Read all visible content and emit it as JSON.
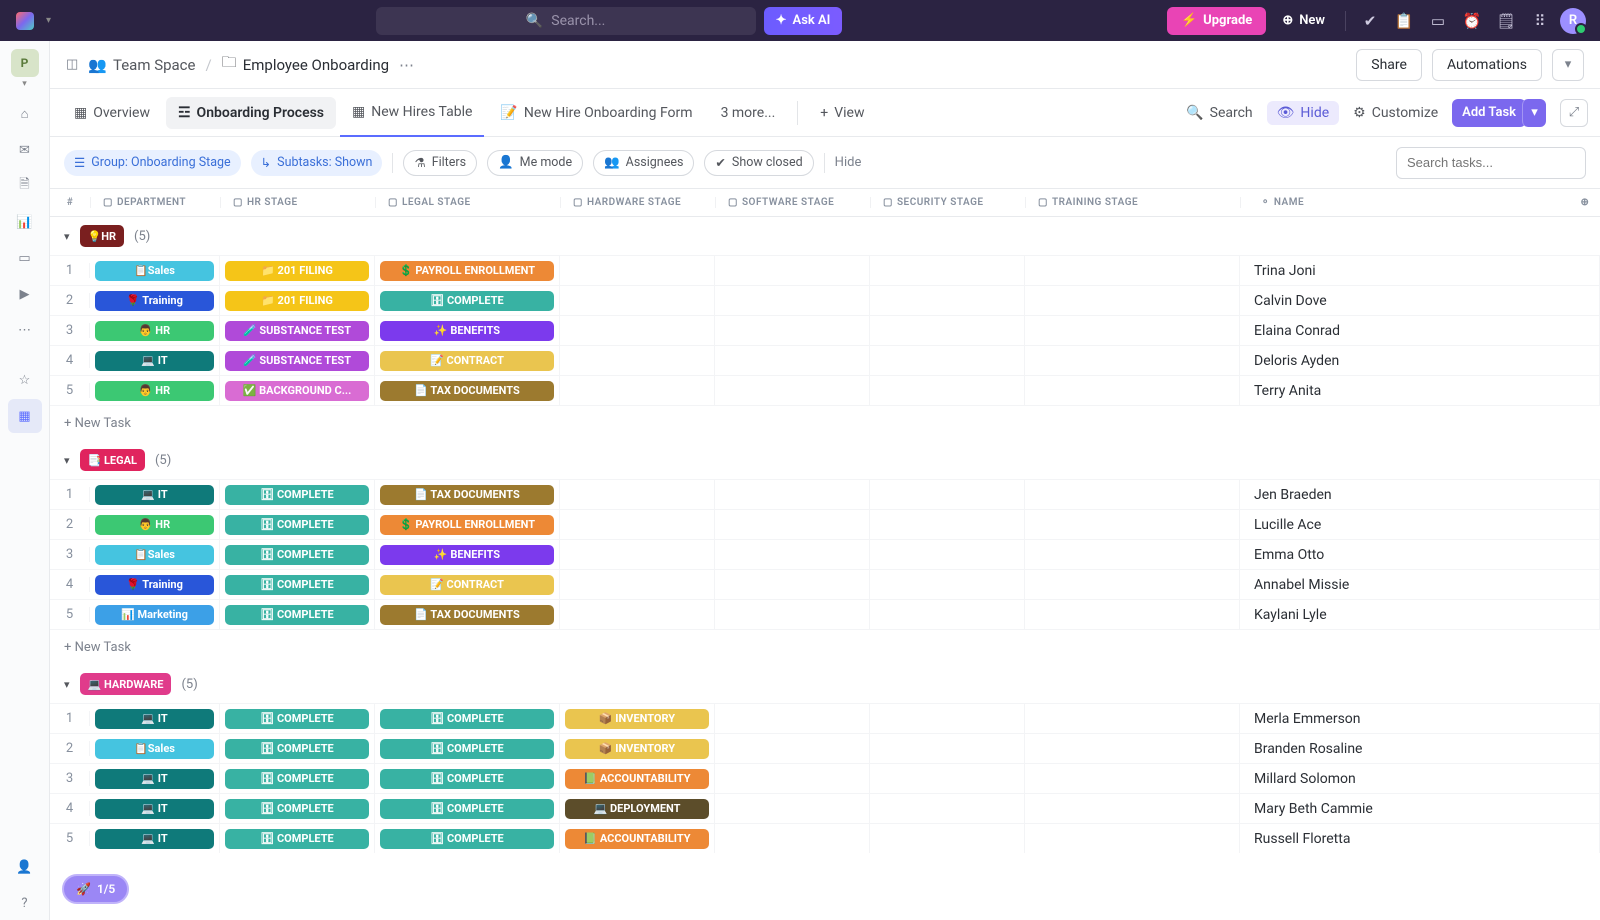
{
  "topbar": {
    "search_placeholder": "Search...",
    "ask_ai": "Ask AI",
    "upgrade": "Upgrade",
    "new": "New",
    "avatar_initial": "R"
  },
  "sidebar": {
    "workspace_initial": "P"
  },
  "breadcrumb": {
    "space": "Team Space",
    "folder": "Employee Onboarding"
  },
  "header_actions": {
    "share": "Share",
    "automations": "Automations"
  },
  "views": {
    "overview": "Overview",
    "process": "Onboarding Process",
    "table": "New Hires Table",
    "form": "New Hire Onboarding Form",
    "more": "3 more...",
    "add_view": "View"
  },
  "viewbar_actions": {
    "search": "Search",
    "hide": "Hide",
    "customize": "Customize",
    "add_task": "Add Task"
  },
  "chips": {
    "group": "Group: Onboarding Stage",
    "subtasks": "Subtasks: Shown",
    "filters": "Filters",
    "me_mode": "Me mode",
    "assignees": "Assignees",
    "show_closed": "Show closed",
    "hide": "Hide",
    "search_placeholder": "Search tasks..."
  },
  "columns": [
    "#",
    "DEPARTMENT",
    "HR STAGE",
    "LEGAL STAGE",
    "HARDWARE STAGE",
    "SOFTWARE STAGE",
    "SECURITY STAGE",
    "TRAINING STAGE",
    "NAME"
  ],
  "pill_colors": {
    "sales": "#45c4e0",
    "training": "#2956d9",
    "hr": "#3cc873",
    "it": "#0f7a7a",
    "marketing": "#3ca0e7",
    "201filing": "#f5c518",
    "substance": "#b04ad9",
    "background": "#d96cd3",
    "payroll": "#ed8936",
    "complete": "#38b2a3",
    "benefits": "#7c3aed",
    "contract": "#eac54f",
    "taxdocs": "#9c7a2f",
    "inventory": "#eac54f",
    "accountability": "#ed8936",
    "deployment": "#5c4d2a",
    "grp_hr": "#7a1f1f",
    "grp_legal": "#e0245e",
    "grp_hardware": "#e03b8b"
  },
  "groups": [
    {
      "badge": "💡HR",
      "count": "(5)",
      "color_key": "grp_hr",
      "rows": [
        {
          "n": "1",
          "dept": {
            "t": "📋Sales",
            "c": "sales"
          },
          "hr": {
            "t": "📁 201 FILING",
            "c": "201filing"
          },
          "legal": {
            "t": "💲 PAYROLL ENROLLMENT",
            "c": "payroll"
          },
          "name": "Trina Joni"
        },
        {
          "n": "2",
          "dept": {
            "t": "🌹 Training",
            "c": "training"
          },
          "hr": {
            "t": "📁 201 FILING",
            "c": "201filing"
          },
          "legal": {
            "t": "🗄 COMPLETE",
            "c": "complete"
          },
          "name": "Calvin Dove"
        },
        {
          "n": "3",
          "dept": {
            "t": "👨 HR",
            "c": "hr"
          },
          "hr": {
            "t": "🧪 SUBSTANCE TEST",
            "c": "substance"
          },
          "legal": {
            "t": "✨ BENEFITS",
            "c": "benefits"
          },
          "name": "Elaina Conrad"
        },
        {
          "n": "4",
          "dept": {
            "t": "💻 IT",
            "c": "it"
          },
          "hr": {
            "t": "🧪 SUBSTANCE TEST",
            "c": "substance"
          },
          "legal": {
            "t": "📝 CONTRACT",
            "c": "contract"
          },
          "name": "Deloris Ayden"
        },
        {
          "n": "5",
          "dept": {
            "t": "👨 HR",
            "c": "hr"
          },
          "hr": {
            "t": "✅ BACKGROUND C...",
            "c": "background"
          },
          "legal": {
            "t": "📄 TAX DOCUMENTS",
            "c": "taxdocs"
          },
          "name": "Terry Anita"
        }
      ]
    },
    {
      "badge": "📑 LEGAL",
      "count": "(5)",
      "color_key": "grp_legal",
      "rows": [
        {
          "n": "1",
          "dept": {
            "t": "💻 IT",
            "c": "it"
          },
          "hr": {
            "t": "🗄 COMPLETE",
            "c": "complete"
          },
          "legal": {
            "t": "📄 TAX DOCUMENTS",
            "c": "taxdocs"
          },
          "name": "Jen Braeden"
        },
        {
          "n": "2",
          "dept": {
            "t": "👨 HR",
            "c": "hr"
          },
          "hr": {
            "t": "🗄 COMPLETE",
            "c": "complete"
          },
          "legal": {
            "t": "💲 PAYROLL ENROLLMENT",
            "c": "payroll"
          },
          "name": "Lucille Ace"
        },
        {
          "n": "3",
          "dept": {
            "t": "📋Sales",
            "c": "sales"
          },
          "hr": {
            "t": "🗄 COMPLETE",
            "c": "complete"
          },
          "legal": {
            "t": "✨ BENEFITS",
            "c": "benefits"
          },
          "name": "Emma Otto"
        },
        {
          "n": "4",
          "dept": {
            "t": "🌹 Training",
            "c": "training"
          },
          "hr": {
            "t": "🗄 COMPLETE",
            "c": "complete"
          },
          "legal": {
            "t": "📝 CONTRACT",
            "c": "contract"
          },
          "name": "Annabel Missie"
        },
        {
          "n": "5",
          "dept": {
            "t": "📊 Marketing",
            "c": "marketing"
          },
          "hr": {
            "t": "🗄 COMPLETE",
            "c": "complete"
          },
          "legal": {
            "t": "📄 TAX DOCUMENTS",
            "c": "taxdocs"
          },
          "name": "Kaylani Lyle"
        }
      ]
    },
    {
      "badge": "💻 HARDWARE",
      "count": "(5)",
      "color_key": "grp_hardware",
      "rows": [
        {
          "n": "1",
          "dept": {
            "t": "💻 IT",
            "c": "it"
          },
          "hr": {
            "t": "🗄 COMPLETE",
            "c": "complete"
          },
          "legal": {
            "t": "🗄 COMPLETE",
            "c": "complete"
          },
          "hw": {
            "t": "📦 INVENTORY",
            "c": "inventory"
          },
          "name": "Merla Emmerson"
        },
        {
          "n": "2",
          "dept": {
            "t": "📋Sales",
            "c": "sales"
          },
          "hr": {
            "t": "🗄 COMPLETE",
            "c": "complete"
          },
          "legal": {
            "t": "🗄 COMPLETE",
            "c": "complete"
          },
          "hw": {
            "t": "📦 INVENTORY",
            "c": "inventory"
          },
          "name": "Branden Rosaline"
        },
        {
          "n": "3",
          "dept": {
            "t": "💻 IT",
            "c": "it"
          },
          "hr": {
            "t": "🗄 COMPLETE",
            "c": "complete"
          },
          "legal": {
            "t": "🗄 COMPLETE",
            "c": "complete"
          },
          "hw": {
            "t": "📗 ACCOUNTABILITY",
            "c": "accountability"
          },
          "name": "Millard Solomon"
        },
        {
          "n": "4",
          "dept": {
            "t": "💻 IT",
            "c": "it"
          },
          "hr": {
            "t": "🗄 COMPLETE",
            "c": "complete"
          },
          "legal": {
            "t": "🗄 COMPLETE",
            "c": "complete"
          },
          "hw": {
            "t": "💻 DEPLOYMENT",
            "c": "deployment"
          },
          "name": "Mary Beth Cammie"
        },
        {
          "n": "5",
          "dept": {
            "t": "💻 IT",
            "c": "it"
          },
          "hr": {
            "t": "🗄 COMPLETE",
            "c": "complete"
          },
          "legal": {
            "t": "🗄 COMPLETE",
            "c": "complete"
          },
          "hw": {
            "t": "📗 ACCOUNTABILITY",
            "c": "accountability"
          },
          "name": "Russell Floretta"
        }
      ]
    }
  ],
  "new_task_label": "+ New Task",
  "progress": "1/5"
}
